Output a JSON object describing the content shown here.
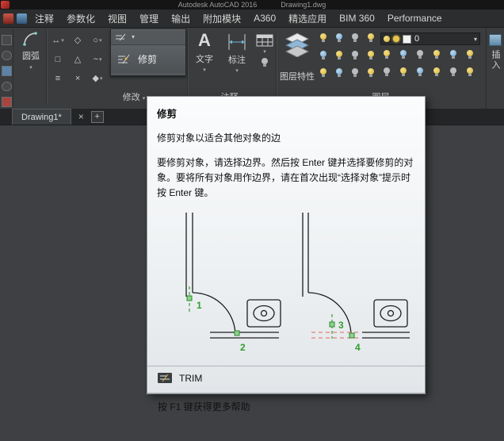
{
  "colors": {
    "marker_green": "#2f9e2f",
    "trim_dash_red": "#e2807d",
    "ribbon_bg": "#3a3c3d",
    "tooltip_bg": "#eef1f3"
  },
  "title_bar": {
    "app_title": "Autodesk AutoCAD 2016",
    "doc_title": "Drawing1.dwg"
  },
  "menu_tabs": [
    "注释",
    "参数化",
    "视图",
    "管理",
    "输出",
    "附加模块",
    "A360",
    "精选应用",
    "BIM 360",
    "Performance"
  ],
  "icons": {
    "dropdown_arrow": "▾",
    "panel_flyout_arrow": "▼",
    "close": "×",
    "new_tab": "+",
    "text_tool": "A"
  },
  "modify_tool_glyphs": [
    "↔",
    "◇",
    "○",
    "□",
    "△",
    "~",
    "≡",
    "×",
    "◆"
  ],
  "ribbon": {
    "arc_label": "圆弧",
    "trim_label": "修剪",
    "text_label": "文字",
    "dimension_label": "标注",
    "layer_properties_label": "图层特性",
    "layer_dropdown_value": "0",
    "insert_label": "插入",
    "modify_panel_label": "修改",
    "annotation_panel_label": "注释",
    "layer_panel_label": "图层"
  },
  "document_tabs": {
    "active_tab": "Drawing1*"
  },
  "tooltip": {
    "title": "修剪",
    "subtitle": "修剪对象以适合其他对象的边",
    "body": "要修剪对象，请选择边界。然后按 Enter 键并选择要修剪的对象。要将所有对象用作边界，请在首次出现“选择对象”提示时按 Enter 键。",
    "command_name": "TRIM",
    "help_text": "按 F1 键获得更多帮助",
    "markers": {
      "m1": "1",
      "m2": "2",
      "m3": "3",
      "m4": "4"
    }
  }
}
